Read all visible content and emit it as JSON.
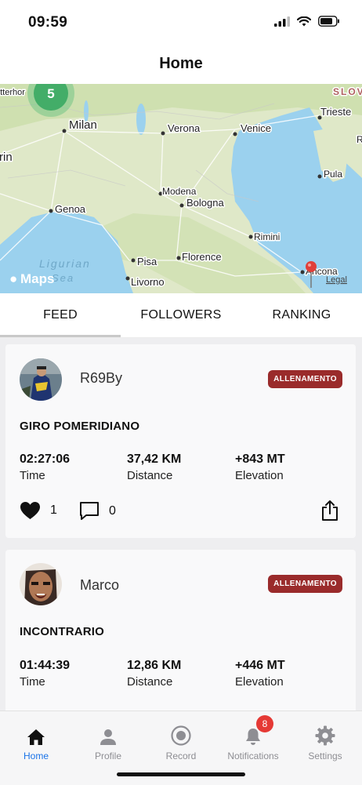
{
  "status_bar": {
    "time": "09:59"
  },
  "nav": {
    "title": "Home"
  },
  "map": {
    "cluster_count": "5",
    "provider": "Maps",
    "legal": "Legal",
    "labels": {
      "matterhorn": "atterhor",
      "slovenia": "SLOV",
      "milan": "Milan",
      "verona": "Verona",
      "venice": "Venice",
      "trieste": "Trieste",
      "turin": "rin",
      "modena": "Modena",
      "bologna": "Bologna",
      "genoa": "Genoa",
      "pula": "Pula",
      "rimini": "Rimini",
      "ligurian": "Ligurian",
      "sea": "Sea",
      "pisa": "Pisa",
      "florence": "Florence",
      "livorno": "Livorno",
      "ancona": "Ancona",
      "r": "R"
    }
  },
  "tabs": [
    {
      "label": "FEED"
    },
    {
      "label": "FOLLOWERS"
    },
    {
      "label": "RANKING"
    }
  ],
  "feed": [
    {
      "username": "R69By",
      "badge": "ALLENAMENTO",
      "title": "GIRO POMERIDIANO",
      "time": "02:27:06",
      "time_label": "Time",
      "distance": "37,42 KM",
      "distance_label": "Distance",
      "elevation": "+843 MT",
      "elevation_label": "Elevation",
      "likes": "1",
      "comments": "0"
    },
    {
      "username": "Marco",
      "badge": "ALLENAMENTO",
      "title": "INCONTRARIO",
      "time": "01:44:39",
      "time_label": "Time",
      "distance": "12,86 KM",
      "distance_label": "Distance",
      "elevation": "+446 MT",
      "elevation_label": "Elevation"
    }
  ],
  "bottom_nav": [
    {
      "label": "Home",
      "icon": "home-icon",
      "active": true
    },
    {
      "label": "Profile",
      "icon": "person-icon"
    },
    {
      "label": "Record",
      "icon": "record-icon"
    },
    {
      "label": "Notifications",
      "icon": "bell-icon",
      "badge": "8"
    },
    {
      "label": "Settings",
      "icon": "gear-icon"
    }
  ],
  "colors": {
    "accent": "#1a73e8",
    "badge": "#9a2b2b",
    "notification_badge": "#e53935",
    "sea": "#9bd1ee",
    "land": "#dfe8c8"
  }
}
